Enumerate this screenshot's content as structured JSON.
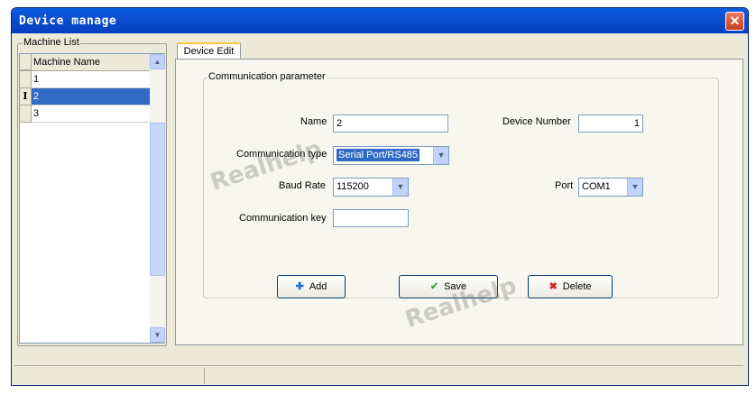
{
  "window": {
    "title": "Device manage",
    "close_glyph": "✕"
  },
  "machine_list": {
    "legend": "Machine List",
    "header": "Machine Name",
    "rows": [
      {
        "indicator": "",
        "name": "1"
      },
      {
        "indicator": "I",
        "name": "2",
        "selected": true
      },
      {
        "indicator": "",
        "name": "3"
      }
    ]
  },
  "tab": {
    "label": "Device Edit"
  },
  "comm": {
    "legend": "Communication parameter",
    "name_label": "Name",
    "name_value": "2",
    "device_number_label": "Device Number",
    "device_number_value": "1",
    "comm_type_label": "Communication type",
    "comm_type_value": "Serial Port/RS485",
    "baud_label": "Baud Rate",
    "baud_value": "115200",
    "port_label": "Port",
    "port_value": "COM1",
    "key_label": "Communication key",
    "key_value": ""
  },
  "buttons": {
    "add_label": "Add",
    "save_label": "Save",
    "delete_label": "Delete"
  },
  "watermark": "Realhelp",
  "colors": {
    "title_bar": "#0a54d8",
    "selection": "#316ac5",
    "add_icon": "#1f6fd0",
    "save_icon": "#2eaa3c",
    "delete_icon": "#d8241c"
  }
}
